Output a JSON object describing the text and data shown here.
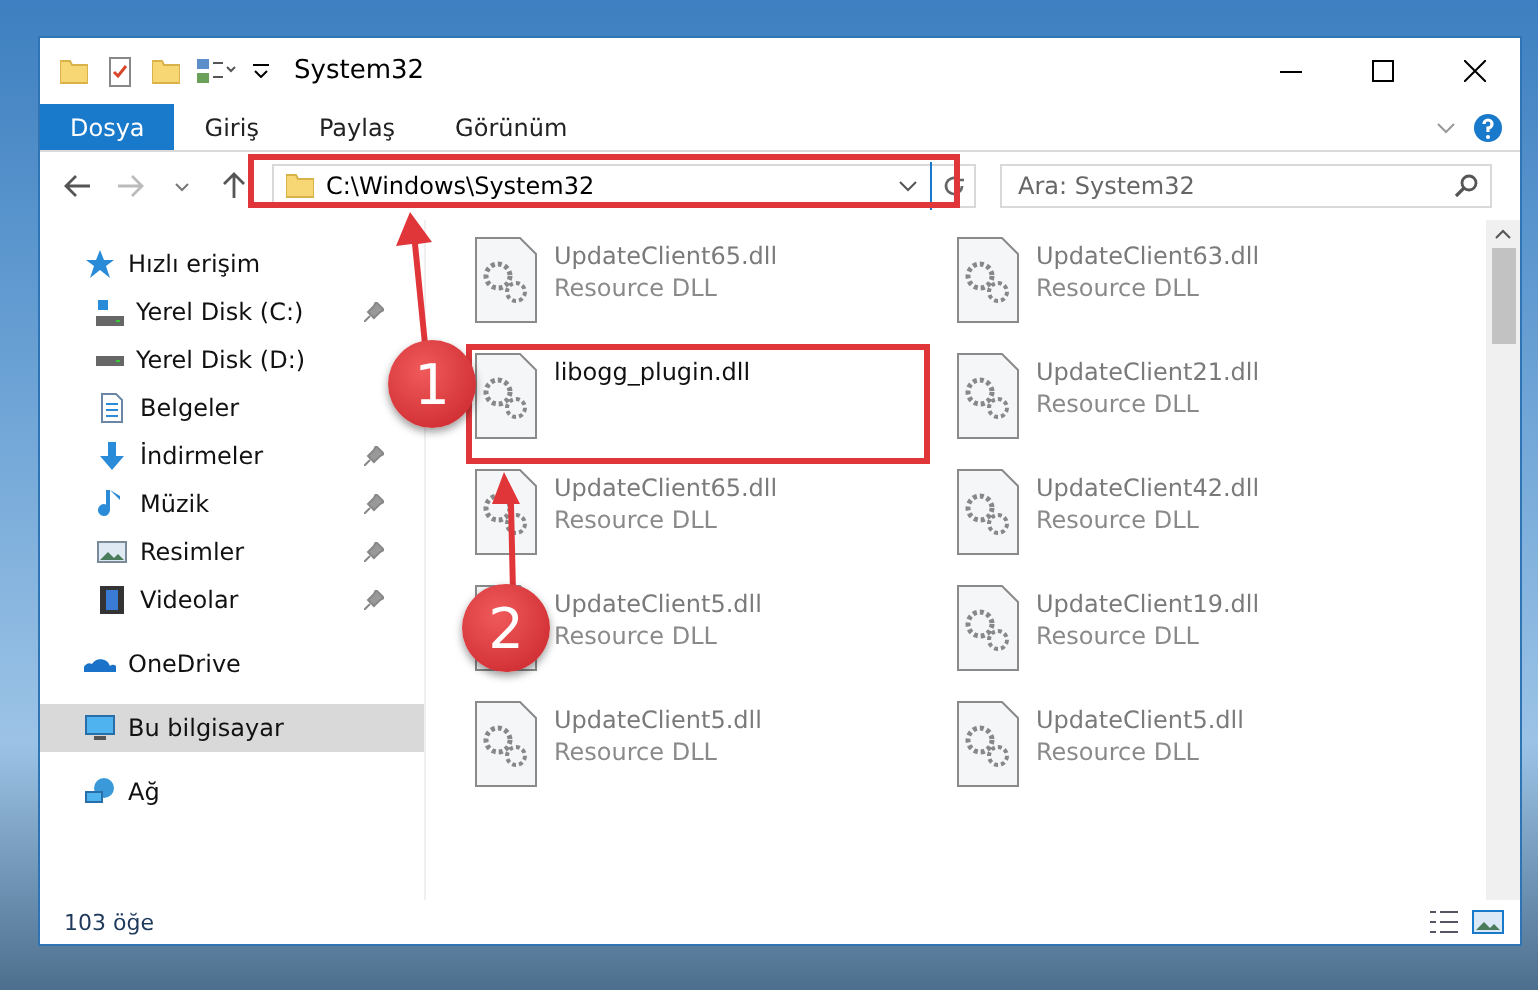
{
  "window": {
    "title": "System32"
  },
  "ribbon": {
    "tabs": [
      {
        "label": "Dosya",
        "selected": true
      },
      {
        "label": "Giriş",
        "selected": false
      },
      {
        "label": "Paylaş",
        "selected": false
      },
      {
        "label": "Görünüm",
        "selected": false
      }
    ]
  },
  "address": {
    "value": "C:\\Windows\\System32"
  },
  "search": {
    "placeholder": "Ara: System32"
  },
  "sidebar": {
    "items": [
      {
        "label": "Hızlı erişim",
        "kind": "star",
        "selected": false,
        "children": [
          {
            "label": "Yerel Disk (C:)",
            "kind": "drive-c",
            "pinned": true,
            "selected": false
          },
          {
            "label": "Yerel Disk (D:)",
            "kind": "drive",
            "pinned": false,
            "selected": false
          },
          {
            "label": "Belgeler",
            "kind": "documents",
            "pinned": false,
            "selected": false
          },
          {
            "label": "İndirmeler",
            "kind": "download",
            "pinned": true,
            "selected": false
          },
          {
            "label": "Müzik",
            "kind": "music",
            "pinned": true,
            "selected": false
          },
          {
            "label": "Resimler",
            "kind": "pictures",
            "pinned": true,
            "selected": false
          },
          {
            "label": "Videolar",
            "kind": "videos",
            "pinned": true,
            "selected": false
          }
        ]
      },
      {
        "label": "OneDrive",
        "kind": "cloud",
        "selected": false
      },
      {
        "label": "Bu bilgisayar",
        "kind": "computer",
        "selected": true
      },
      {
        "label": "Ağ",
        "kind": "network",
        "selected": false
      }
    ]
  },
  "files": [
    {
      "name": "UpdateClient65.dll",
      "type": "Resource DLL",
      "faded": true
    },
    {
      "name": "UpdateClient63.dll",
      "type": "Resource DLL",
      "faded": true
    },
    {
      "name": "libogg_plugin.dll",
      "faded": false
    },
    {
      "name": "UpdateClient21.dll",
      "type": "Resource DLL",
      "faded": true
    },
    {
      "name": "UpdateClient65.dll",
      "type": "Resource DLL",
      "faded": true
    },
    {
      "name": "UpdateClient42.dll",
      "type": "Resource DLL",
      "faded": true
    },
    {
      "name": "UpdateClient5.dll",
      "type": "Resource DLL",
      "faded": true
    },
    {
      "name": "UpdateClient19.dll",
      "type": "Resource DLL",
      "faded": true
    },
    {
      "name": "UpdateClient5.dll",
      "type": "Resource DLL",
      "faded": true
    },
    {
      "name": "UpdateClient5.dll",
      "type": "Resource DLL",
      "faded": true
    }
  ],
  "status_bar": {
    "count": "103 öğe"
  },
  "annotations": [
    {
      "number": "1"
    },
    {
      "number": "2"
    }
  ]
}
